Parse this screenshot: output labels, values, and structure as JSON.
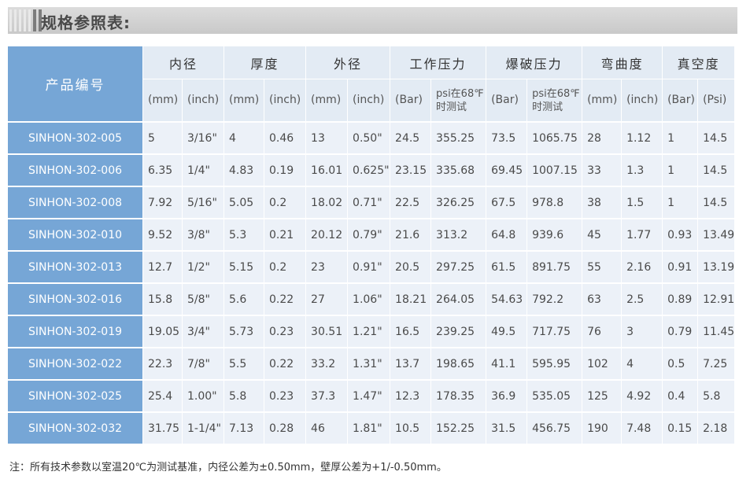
{
  "title": "规格参照表:",
  "header": {
    "product_code": "产品编号",
    "groups": [
      {
        "label": "内径",
        "units": [
          "(mm)",
          "(inch)"
        ]
      },
      {
        "label": "厚度",
        "units": [
          "(mm)",
          "(inch)"
        ]
      },
      {
        "label": "外径",
        "units": [
          "(mm)",
          "(inch)"
        ]
      },
      {
        "label": "工作压力",
        "units": [
          "(Bar)",
          "psi在68℉\n时测试"
        ]
      },
      {
        "label": "爆破压力",
        "units": [
          "(Bar)",
          "psi在68℉\n时测试"
        ]
      },
      {
        "label": "弯曲度",
        "units": [
          "(mm)",
          "(inch)"
        ]
      },
      {
        "label": "真空度",
        "units": [
          "(Bar)",
          "(Psi)"
        ]
      }
    ]
  },
  "rows": [
    {
      "code": "SINHON-302-005",
      "values": [
        "5",
        "3/16\"",
        "4",
        "0.46",
        "13",
        "0.50\"",
        "24.5",
        "355.25",
        "73.5",
        "1065.75",
        "28",
        "1.12",
        "1",
        "14.5"
      ]
    },
    {
      "code": "SINHON-302-006",
      "values": [
        "6.35",
        "1/4\"",
        "4.83",
        "0.19",
        "16.01",
        "0.625\"",
        "23.15",
        "335.68",
        "69.45",
        "1007.15",
        "33",
        "1.3",
        "1",
        "14.5"
      ]
    },
    {
      "code": "SINHON-302-008",
      "values": [
        "7.92",
        "5/16\"",
        "5.05",
        "0.2",
        "18.02",
        "0.71\"",
        "22.5",
        "326.25",
        "67.5",
        "978.8",
        "38",
        "1.5",
        "1",
        "14.5"
      ]
    },
    {
      "code": "SINHON-302-010",
      "values": [
        "9.52",
        "3/8\"",
        "5.3",
        "0.21",
        "20.12",
        "0.79\"",
        "21.6",
        "313.2",
        "64.8",
        "939.6",
        "45",
        "1.77",
        "0.93",
        "13.49"
      ]
    },
    {
      "code": "SINHON-302-013",
      "values": [
        "12.7",
        "1/2\"",
        "5.15",
        "0.2",
        "23",
        "0.91\"",
        "20.5",
        "297.25",
        "61.5",
        "891.75",
        "55",
        "2.16",
        "0.91",
        "13.19"
      ]
    },
    {
      "code": "SINHON-302-016",
      "values": [
        "15.8",
        "5/8\"",
        "5.6",
        "0.22",
        "27",
        "1.06\"",
        "18.21",
        "264.05",
        "54.63",
        "792.2",
        "63",
        "2.5",
        "0.89",
        "12.91"
      ]
    },
    {
      "code": "SINHON-302-019",
      "values": [
        "19.05",
        "3/4\"",
        "5.73",
        "0.23",
        "30.51",
        "1.21\"",
        "16.5",
        "239.25",
        "49.5",
        "717.75",
        "76",
        "3",
        "0.79",
        "11.45"
      ]
    },
    {
      "code": "SINHON-302-022",
      "values": [
        "22.3",
        "7/8\"",
        "5.5",
        "0.22",
        "33.2",
        "1.31\"",
        "13.7",
        "198.65",
        "41.1",
        "595.95",
        "102",
        "4",
        "0.5",
        "7.25"
      ]
    },
    {
      "code": "SINHON-302-025",
      "values": [
        "25.4",
        "1.00\"",
        "5.8",
        "0.23",
        "37.3",
        "1.47\"",
        "12.3",
        "178.35",
        "36.9",
        "535.05",
        "125",
        "4.92",
        "0.4",
        "5.8"
      ]
    },
    {
      "code": "SINHON-302-032",
      "values": [
        "31.75",
        "1-1/4\"",
        "7.13",
        "0.28",
        "46",
        "1.81\"",
        "10.5",
        "152.25",
        "31.5",
        "456.75",
        "190",
        "7.48",
        "0.15",
        "2.18"
      ]
    }
  ],
  "footnote": "注：所有技术参数以室温20℃为测试基准，内径公差为±0.50mm，壁厚公差为+1/-0.50mm。",
  "colors": {
    "code_column": "#76a6d6",
    "header_bg": "#e3ebf4",
    "cell_bg": "#ecf1f8",
    "title_bar": "#cfcfcf"
  }
}
